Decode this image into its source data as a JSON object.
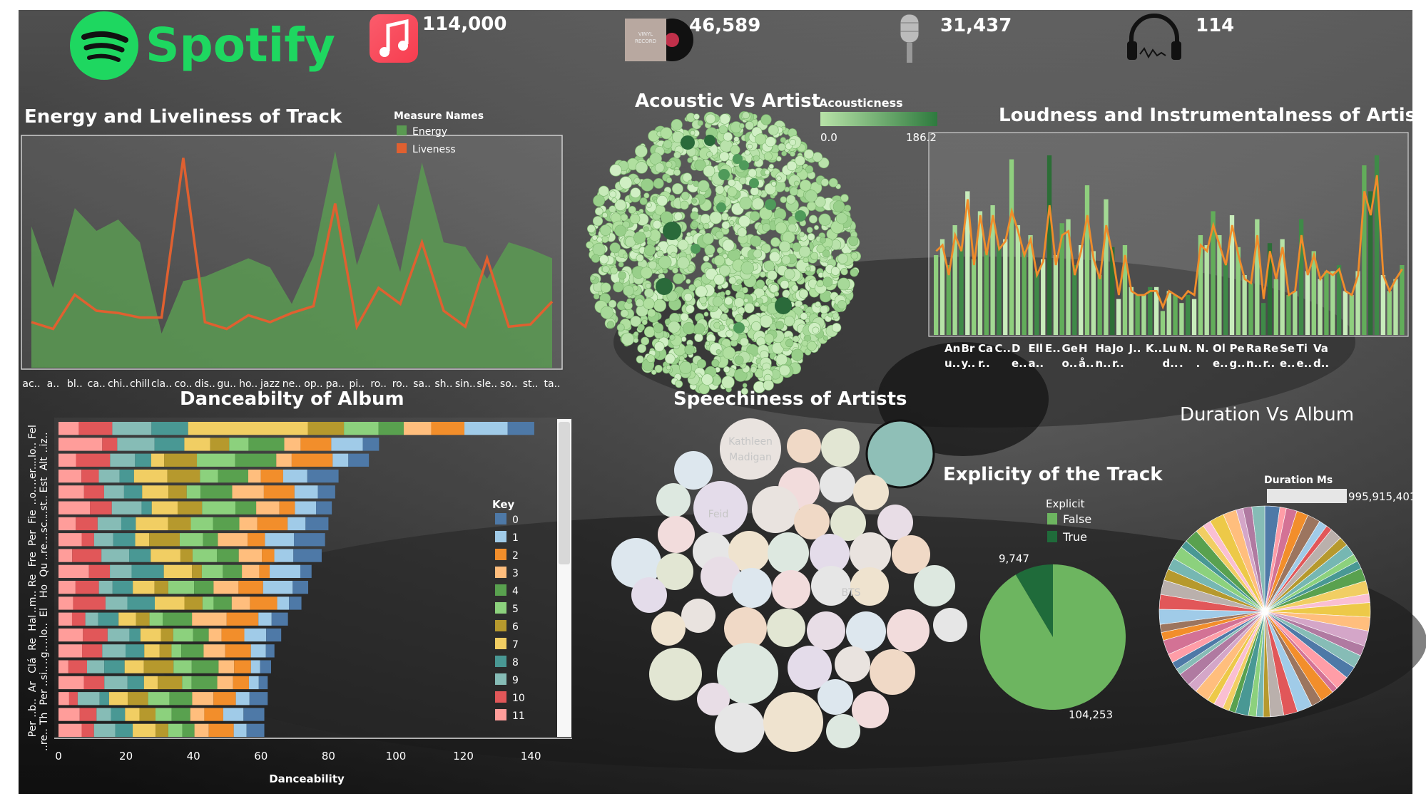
{
  "header": {
    "brand": "Spotify",
    "kpis": [
      {
        "value": "114,000",
        "icon": "music-note-icon"
      },
      {
        "value": "46,589",
        "icon": "vinyl-record-icon"
      },
      {
        "value": "31,437",
        "icon": "microphone-icon"
      },
      {
        "value": "114",
        "icon": "headphones-icon"
      }
    ]
  },
  "colors": {
    "spotify_green": "#1ed760",
    "energy": "#5a9a52",
    "liveness": "#e06030",
    "acoustic_light": "#a8d89c",
    "acoustic_dark": "#2a6a3a",
    "explicit_false": "#6db560",
    "explicit_true": "#1f6b3a"
  },
  "chart_data": [
    {
      "type": "area",
      "title": "Energy and Liveliness of Track",
      "legend_title": "Measure Names",
      "legend": [
        "Energy",
        "Liveness"
      ],
      "categories": [
        "ac..",
        "a..",
        "bl..",
        "ca..",
        "chi..",
        "chill",
        "cla..",
        "co..",
        "dis..",
        "gu..",
        "ho..",
        "jazz",
        "ne..",
        "op..",
        "pa..",
        "pi..",
        "ro..",
        "ro..",
        "sa..",
        "sh..",
        "sin..",
        "sle..",
        "so..",
        "st..",
        "ta.."
      ],
      "series": [
        {
          "name": "Energy",
          "values": [
            0.62,
            0.35,
            0.7,
            0.6,
            0.65,
            0.55,
            0.15,
            0.38,
            0.4,
            0.44,
            0.48,
            0.44,
            0.28,
            0.49,
            0.95,
            0.45,
            0.72,
            0.42,
            0.9,
            0.55,
            0.53,
            0.39,
            0.55,
            0.52,
            0.48
          ]
        },
        {
          "name": "Liveness",
          "values": [
            0.2,
            0.17,
            0.32,
            0.25,
            0.24,
            0.22,
            0.22,
            0.92,
            0.2,
            0.17,
            0.23,
            0.2,
            0.24,
            0.27,
            0.72,
            0.18,
            0.35,
            0.28,
            0.55,
            0.25,
            0.18,
            0.48,
            0.18,
            0.19,
            0.29
          ]
        }
      ]
    },
    {
      "type": "scatter",
      "title": "Acoustic Vs Artist",
      "legend_title": "Acousticness",
      "range": [
        "0.0",
        "186.2"
      ]
    },
    {
      "type": "bar",
      "title": "Loudness and Instrumentalness of Artist",
      "categories": [
        "An\nu..",
        "Br\ny..",
        "Ca\nr..",
        "C..",
        "D\ne..",
        "Ell\na..",
        "E..",
        "Ge\no..",
        "H\nå..",
        "Ha\nn..",
        "Jo\nr..",
        "J..",
        "K..",
        "Lu\nd..",
        "N.\n.",
        "N.\n.",
        "Ol\ne..",
        "Pe\ng..",
        "Ra\nn..",
        "Re\nr..",
        "Se\ne..",
        "Ti\ne..",
        "Va\nd.."
      ],
      "bar_values": [
        0.4,
        0.48,
        0.35,
        0.55,
        0.44,
        0.72,
        0.38,
        0.62,
        0.42,
        0.65,
        0.45,
        0.48,
        0.88,
        0.55,
        0.42,
        0.5,
        0.32,
        0.38,
        0.9,
        0.4,
        0.56,
        0.58,
        0.35,
        0.45,
        0.75,
        0.42,
        0.3,
        0.68,
        0.44,
        0.18,
        0.45,
        0.24,
        0.2,
        0.2,
        0.24,
        0.24,
        0.12,
        0.22,
        0.2,
        0.16,
        0.2,
        0.18,
        0.5,
        0.45,
        0.62,
        0.5,
        0.36,
        0.6,
        0.44,
        0.3,
        0.26,
        0.58,
        0.16,
        0.46,
        0.28,
        0.48,
        0.2,
        0.22,
        0.58,
        0.32,
        0.42,
        0.28,
        0.32,
        0.32,
        0.35,
        0.22,
        0.2,
        0.32,
        0.85,
        0.72,
        0.9,
        0.3,
        0.22,
        0.28,
        0.35
      ],
      "line_values": [
        0.42,
        0.45,
        0.3,
        0.5,
        0.42,
        0.68,
        0.35,
        0.6,
        0.4,
        0.6,
        0.43,
        0.47,
        0.62,
        0.52,
        0.4,
        0.48,
        0.3,
        0.37,
        0.65,
        0.35,
        0.5,
        0.52,
        0.3,
        0.42,
        0.6,
        0.38,
        0.28,
        0.55,
        0.4,
        0.2,
        0.4,
        0.22,
        0.2,
        0.2,
        0.22,
        0.22,
        0.14,
        0.22,
        0.2,
        0.18,
        0.22,
        0.2,
        0.45,
        0.42,
        0.55,
        0.45,
        0.35,
        0.55,
        0.4,
        0.28,
        0.26,
        0.5,
        0.18,
        0.42,
        0.28,
        0.44,
        0.2,
        0.22,
        0.5,
        0.3,
        0.4,
        0.28,
        0.32,
        0.3,
        0.33,
        0.22,
        0.2,
        0.3,
        0.72,
        0.6,
        0.8,
        0.3,
        0.22,
        0.28,
        0.33
      ]
    },
    {
      "type": "bar",
      "title": "Danceabilty of Album",
      "xlabel": "Danceability",
      "xlim": [
        0,
        140
      ],
      "xticks": [
        0,
        20,
        40,
        60,
        80,
        100,
        120,
        140
      ],
      "legend_title": "Key",
      "keys": [
        "0",
        "1",
        "2",
        "3",
        "4",
        "5",
        "6",
        "7",
        "8",
        "9",
        "10",
        "11"
      ],
      "key_colors": [
        "#4e79a7",
        "#a0cbe8",
        "#f28e2b",
        "#ffbe7d",
        "#59a14f",
        "#8cd17d",
        "#b6992d",
        "#f1ce63",
        "#499894",
        "#86bcb6",
        "#e15759",
        "#ff9d9a"
      ],
      "row_labels_visible": [
        "Fel",
        "..iz..",
        "..lo..",
        "Alt",
        "..er..",
        "Est",
        "..o..",
        "..st..",
        "Fie",
        "..sc..",
        "Per",
        "..re..",
        "Fre",
        "Qu",
        "Re",
        "Ho",
        "..m..",
        "El",
        "Hal",
        "..lo..",
        "Re",
        "..g..",
        "Clá",
        "..si..",
        "Ar",
        "Per",
        "..b..",
        "Th",
        "Per",
        "..re.."
      ],
      "totals": [
        141,
        95,
        92,
        83,
        82,
        81,
        80,
        79,
        78,
        75,
        74,
        72,
        68,
        66,
        64,
        63,
        62,
        62,
        61,
        61
      ]
    },
    {
      "type": "scatter",
      "title": "Speechiness  of Artists",
      "bubble_labels": [
        "Kathleen\nMadigan",
        "Feid",
        "BTS"
      ]
    },
    {
      "type": "pie",
      "title": "Explicity of the Track",
      "legend_title": "Explicit",
      "categories": [
        "False",
        "True"
      ],
      "values": [
        104253,
        9747
      ],
      "value_labels": [
        "104,253",
        "9,747"
      ]
    },
    {
      "type": "pie",
      "title": "Duration Vs Album",
      "legend_title": "Duration Ms",
      "max_label": "995,915,401",
      "slices": 60
    }
  ]
}
